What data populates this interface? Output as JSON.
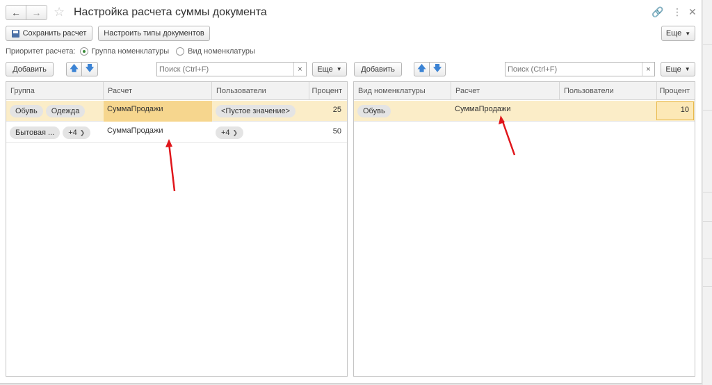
{
  "window": {
    "title": "Настройка расчета суммы документа",
    "icons": [
      "back-arrow-icon",
      "forward-arrow-icon",
      "star-icon",
      "link-icon",
      "more-vertical-icon",
      "close-icon"
    ]
  },
  "toolbar": {
    "save_label": "Сохранить расчет",
    "config_types_label": "Настроить типы документов",
    "more_label": "Еще"
  },
  "priority": {
    "label": "Приоритет расчета:",
    "options": [
      {
        "label": "Группа номенклатуры",
        "selected": true
      },
      {
        "label": "Вид номенклатуры",
        "selected": false
      }
    ]
  },
  "left_panel": {
    "add_label": "Добавить",
    "search_placeholder": "Поиск (Ctrl+F)",
    "clear_glyph": "×",
    "more_label": "Еще",
    "columns": [
      "Группа",
      "Расчет",
      "Пользователи",
      "Процент"
    ],
    "rows": [
      {
        "groups": [
          "Обувь",
          "Одежда"
        ],
        "calc": "СуммаПродажи",
        "users": "<Пустое значение>",
        "percent": "25",
        "selected": true
      },
      {
        "groups": [
          "Бытовая ...",
          "+4"
        ],
        "calc": "СуммаПродажи",
        "users": "+4",
        "percent": "50",
        "selected": false
      }
    ]
  },
  "right_panel": {
    "add_label": "Добавить",
    "search_placeholder": "Поиск (Ctrl+F)",
    "clear_glyph": "×",
    "more_label": "Еще",
    "columns": [
      "Вид номенклатуры",
      "Расчет",
      "Пользователи",
      "Процент"
    ],
    "rows": [
      {
        "kind": "Обувь",
        "calc": "СуммаПродажи",
        "users": "",
        "percent": "10",
        "selected": true
      }
    ]
  },
  "colors": {
    "selected_row": "#fbedc8",
    "selected_cell": "#f6d68e",
    "annotation_arrow": "#e0161b",
    "radio_on": "#3a8c3a",
    "updown_arrows": "#3b83d4"
  }
}
